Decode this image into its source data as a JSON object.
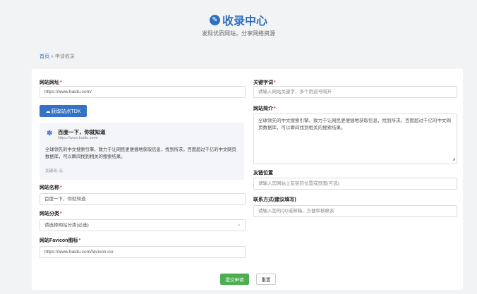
{
  "header": {
    "title": "收录中心",
    "subtitle": "发现优质网站，分享网络资源"
  },
  "breadcrumb": {
    "home": "首页",
    "separator": "»",
    "current": "申请收录"
  },
  "form": {
    "url": {
      "label": "网站网址",
      "required": "*",
      "value": "https://www.baidu.com/"
    },
    "tdk_button": {
      "label": "获取站点TDK",
      "icon": "cloud-icon"
    },
    "preview": {
      "icon": "baidu-paw-icon",
      "title": "百度一下，你就知道",
      "url": "https://www.baidu.com/",
      "description": "全球领先的中文搜索引擎、致力于让网民更便捷地获取信息，找到所求。百度超过千亿的中文网页数据库，可以瞬间找到相关的搜索结果。",
      "keywords": "关键词: 无"
    },
    "name": {
      "label": "网站名称",
      "required": "*",
      "value": "百度一下，你就知道"
    },
    "category": {
      "label": "网站分类",
      "required": "*",
      "value": "请选择网站分类(必选)"
    },
    "favicon": {
      "label": "网站Favicon图标",
      "required": "*",
      "value": "https://www.baidu.com/favicon.ico"
    },
    "keywords": {
      "label": "关键字词",
      "required": "*",
      "placeholder": "请输入网站关键字，多个用逗号隔开"
    },
    "intro": {
      "label": "网站简介",
      "required": "*",
      "value": "全球领先的中文搜索引擎、致力于让网民更便捷地获取信息，找到所求。百度超过千亿的中文网页数据库，可以瞬间找到相关的搜索结果。"
    },
    "link_position": {
      "label": "友链位置",
      "placeholder": "请输入您网站上友链的位置或页面(可选)"
    },
    "contact": {
      "label": "联系方式(建议填写)",
      "placeholder": "请输入您的QQ或邮箱，方便审核联系"
    },
    "submit_label": "提交申请",
    "reset_label": "重置"
  },
  "colors": {
    "accent": "#2e6fbf",
    "tdk_button": "#3473c4",
    "submit": "#4caf50",
    "required": "#e33333",
    "background": "#f2f3f5"
  }
}
